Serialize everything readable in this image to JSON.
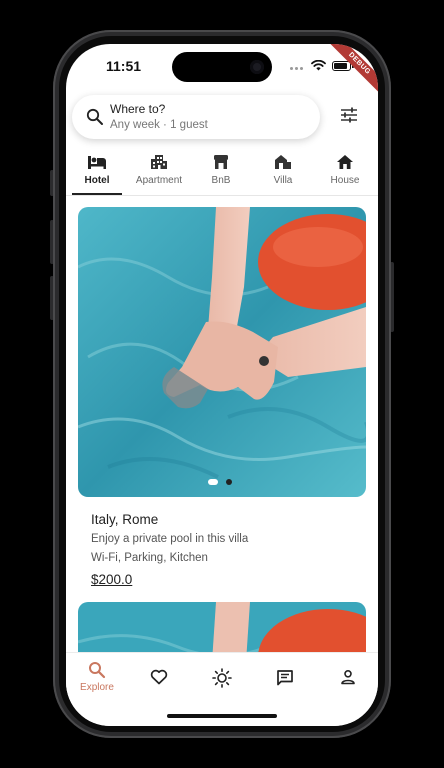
{
  "status": {
    "time": "11:51",
    "debug_label": "DEBUG"
  },
  "search": {
    "title": "Where to?",
    "subtitle": "Any week · 1 guest"
  },
  "categories": [
    {
      "label": "Hotel",
      "icon": "bed-icon",
      "active": true
    },
    {
      "label": "Apartment",
      "icon": "apartment-icon",
      "active": false
    },
    {
      "label": "BnB",
      "icon": "bnb-icon",
      "active": false
    },
    {
      "label": "Villa",
      "icon": "villa-icon",
      "active": false
    },
    {
      "label": "House",
      "icon": "house-icon",
      "active": false
    }
  ],
  "listing": {
    "location": "Italy, Rome",
    "description": "Enjoy a private pool in this villa",
    "amenities": "Wi-Fi, Parking, Kitchen",
    "price": "$200.0",
    "image_count": 2,
    "active_image": 0
  },
  "bottom_nav": [
    {
      "label": "Explore",
      "icon": "search-icon",
      "active": true
    },
    {
      "label": "",
      "icon": "heart-icon",
      "active": false
    },
    {
      "label": "",
      "icon": "sun-icon",
      "active": false
    },
    {
      "label": "",
      "icon": "message-icon",
      "active": false
    },
    {
      "label": "",
      "icon": "person-icon",
      "active": false
    }
  ],
  "colors": {
    "accent": "#c9775f",
    "pool": "#3fa9bf",
    "float": "#e2502f"
  }
}
